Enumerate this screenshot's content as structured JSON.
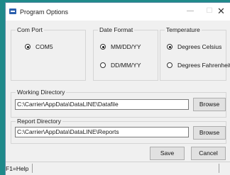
{
  "window": {
    "title": "Program Options",
    "minimize": "—",
    "maximize": "☐",
    "close": "✕"
  },
  "com_port": {
    "legend": "Com Port",
    "options": [
      {
        "label": "COM5",
        "selected": true
      }
    ]
  },
  "date_format": {
    "legend": "Date Format",
    "options": [
      {
        "label": "MM/DD/YY",
        "selected": true
      },
      {
        "label": "DD/MM/YY",
        "selected": false
      }
    ]
  },
  "temperature": {
    "legend": "Temperature",
    "options": [
      {
        "label": "Degrees Celsius",
        "selected": true
      },
      {
        "label": "Degrees Fahrenheit",
        "selected": false
      }
    ]
  },
  "working_directory": {
    "label": "Working Directory",
    "value": "C:\\Carrier\\AppData\\DataLINE\\Datafile",
    "browse": "Browse"
  },
  "report_directory": {
    "label": "Report Directory",
    "value": "C:\\Carrier\\AppData\\DataLINE\\Reports",
    "browse": "Browse"
  },
  "actions": {
    "save": "Save",
    "cancel": "Cancel"
  },
  "status": {
    "help": "F1=Help"
  }
}
